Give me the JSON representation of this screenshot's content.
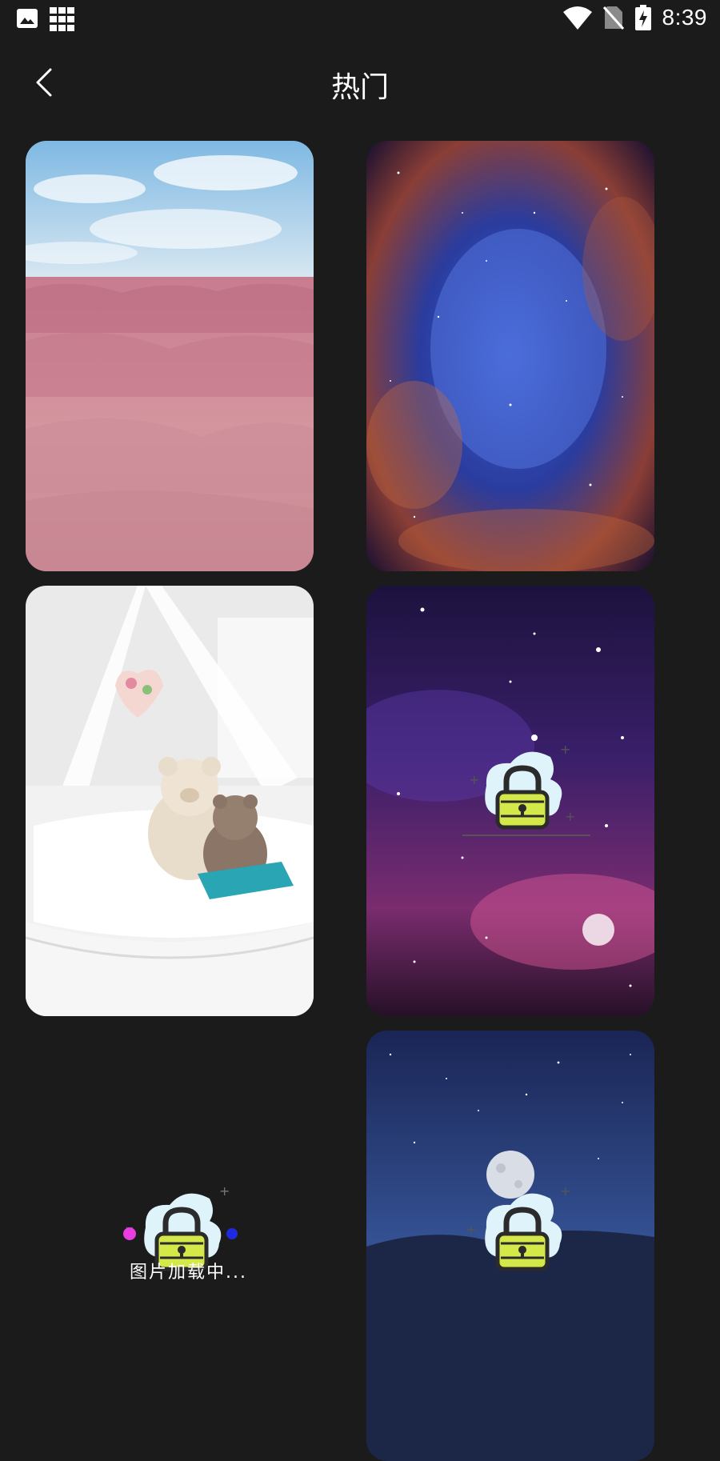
{
  "status_bar": {
    "time": "8:39",
    "left_icons": [
      "image-icon",
      "grid-icon"
    ],
    "right_icons": [
      "wifi-icon",
      "no-sim-icon",
      "battery-charging-icon"
    ]
  },
  "header": {
    "title": "热门",
    "back_icon": "chevron-left-icon"
  },
  "wallpapers": [
    {
      "scene": "pink-grass-field",
      "state": "loaded"
    },
    {
      "scene": "blue-nebula",
      "state": "loaded"
    },
    {
      "scene": "teddy-bear-cradle",
      "state": "loaded"
    },
    {
      "scene": "purple-galaxy",
      "state": "locked"
    },
    {
      "scene": "empty",
      "state": "loading"
    },
    {
      "scene": "moon-night-sky",
      "state": "locked"
    }
  ],
  "loading": {
    "text": "图片加载中..."
  },
  "colors": {
    "background": "#1b1b1b",
    "lock_body": "#d4e84a",
    "lock_cloud": "#dff3fb"
  }
}
